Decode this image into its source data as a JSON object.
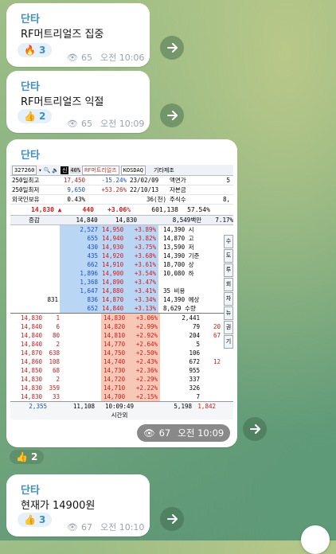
{
  "messages": [
    {
      "sender": "단타",
      "text": "RF머트리얼즈 집중",
      "reaction_emoji": "🔥",
      "reaction_count": "3",
      "views": "65",
      "time": "오전 10:06"
    },
    {
      "sender": "단타",
      "text": "RF머트리얼즈 익절",
      "reaction_emoji": "👍",
      "reaction_count": "2",
      "views": "65",
      "time": "오전 10:09"
    },
    {
      "sender": "단타",
      "views": "67",
      "time": "오전 10:09",
      "reaction_emoji": "👍",
      "reaction_count": "2"
    },
    {
      "sender": "단타",
      "text": "현재가 14900원",
      "reaction_emoji": "👍",
      "reaction_count": "3",
      "views": "67",
      "time": "오전 10:10"
    }
  ],
  "hts": {
    "toolbar": {
      "code": "327260",
      "credit": "신",
      "margin": "40%",
      "name": "RF머트리얼즈",
      "market": "KOSDAQ",
      "sector": "기타제조"
    },
    "info_rows": [
      [
        "250일최고",
        "17,450",
        "-15.24%",
        "23/02/09",
        "액면가",
        "5"
      ],
      [
        "250일최저",
        "9,650",
        "+53.26%",
        "22/10/13",
        "자본금",
        ""
      ],
      [
        "외국인보유",
        "0.43%",
        "",
        "36(천)",
        "주식수",
        "8,"
      ]
    ],
    "price_line": {
      "price": "14,830",
      "arrow": "▲",
      "change": "440",
      "rate": "+3.06%",
      "volume": "601,138",
      "vol_rate": "57.54%"
    },
    "sub_line": {
      "label": "증감",
      "v1": "14,840",
      "v2": "14,830",
      "amount": "8,549백만",
      "ratio": "7.17%"
    },
    "asks": [
      {
        "qty": "2,527",
        "price": "14,950",
        "rate": "+3.89%",
        "extra": "14,390 시"
      },
      {
        "qty": "655",
        "price": "14,940",
        "rate": "+3.82%",
        "extra": "14,870 고"
      },
      {
        "qty": "430",
        "price": "14,930",
        "rate": "+3.75%",
        "extra": "13,590 저"
      },
      {
        "qty": "435",
        "price": "14,920",
        "rate": "+3.68%",
        "extra": "14,390 기준"
      },
      {
        "qty": "662",
        "price": "14,910",
        "rate": "+3.61%",
        "extra": "18,700 상"
      },
      {
        "qty": "1,896",
        "price": "14,900",
        "rate": "+3.54%",
        "extra": "10,080 하"
      },
      {
        "qty": "1,368",
        "price": "14,890",
        "rate": "+3.47%",
        "extra": ""
      },
      {
        "qty": "1,647",
        "price": "14,880",
        "rate": "+3.41%",
        "extra": "35 비용"
      },
      {
        "qty": "836",
        "price": "14,870",
        "rate": "+3.34%",
        "extra": "14,390 예상"
      },
      {
        "qty": "652",
        "price": "14,840",
        "rate": "+3.13%",
        "extra": "8,629 수량"
      }
    ],
    "ask_left_extra": "831",
    "ask_right_extra": "0%",
    "bids": [
      {
        "tp": "14,830",
        "tq": "1",
        "price": "14,830",
        "rate": "+3.06%",
        "qty": "2,441",
        "extra": ""
      },
      {
        "tp": "14,840",
        "tq": "6",
        "price": "14,820",
        "rate": "+2.99%",
        "qty": "79",
        "extra": "20"
      },
      {
        "tp": "14,840",
        "tq": "80",
        "price": "14,810",
        "rate": "+2.92%",
        "qty": "204",
        "extra": "67"
      },
      {
        "tp": "14,840",
        "tq": "2",
        "price": "14,770",
        "rate": "+2.64%",
        "qty": "5",
        "extra": ""
      },
      {
        "tp": "14,870",
        "tq": "638",
        "price": "14,750",
        "rate": "+2.50%",
        "qty": "106",
        "extra": ""
      },
      {
        "tp": "14,860",
        "tq": "108",
        "price": "14,740",
        "rate": "+2.43%",
        "qty": "672",
        "extra": "12"
      },
      {
        "tp": "14,850",
        "tq": "68",
        "price": "14,730",
        "rate": "+2.36%",
        "qty": "955",
        "extra": ""
      },
      {
        "tp": "14,830",
        "tq": "2",
        "price": "14,720",
        "rate": "+2.29%",
        "qty": "337",
        "extra": ""
      },
      {
        "tp": "14,830",
        "tq": "359",
        "price": "14,710",
        "rate": "+2.22%",
        "qty": "326",
        "extra": ""
      },
      {
        "tp": "14,830",
        "tq": "33",
        "price": "14,700",
        "rate": "+2.15%",
        "qty": "7",
        "extra": ""
      }
    ],
    "footer": {
      "left": "2,355",
      "left2": "11,108",
      "time": "10:09:49",
      "time_label": "시간외",
      "right": "5,198",
      "right2": "1,842"
    },
    "side_tabs": [
      "수",
      "도",
      "투",
      "회",
      "차",
      "뉴",
      "권",
      "기"
    ]
  }
}
